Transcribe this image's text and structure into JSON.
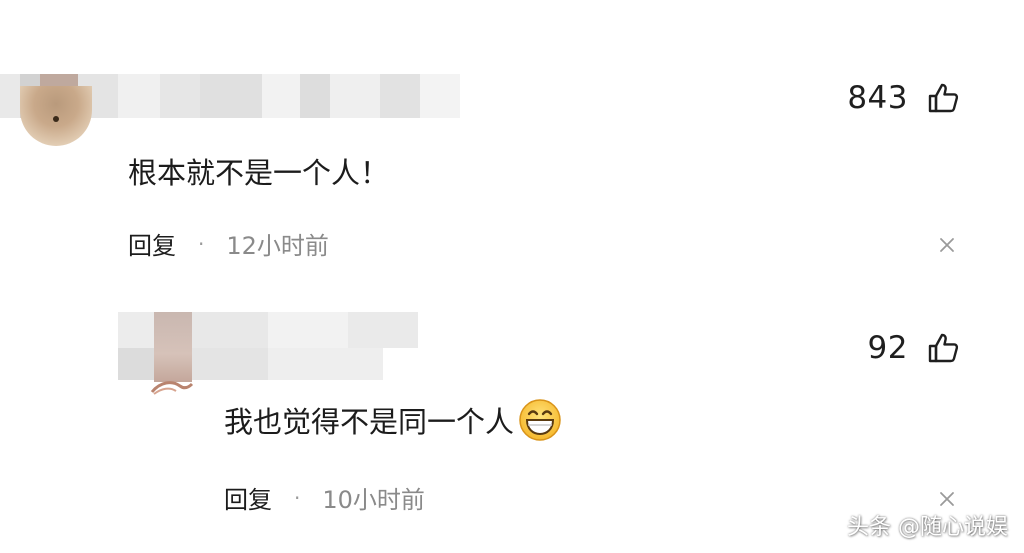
{
  "comments": [
    {
      "likes": "843",
      "text": "根本就不是一个人！",
      "reply_label": "回复",
      "separator": "·",
      "time": "12小时前"
    },
    {
      "likes": "92",
      "text": "我也觉得不是同一个人",
      "emoji": "grinning-face-emoji",
      "reply_label": "回复",
      "separator": "·",
      "time": "10小时前"
    }
  ],
  "icons": {
    "like": "thumbs-up-icon",
    "close": "close-icon"
  },
  "watermark": "头条 @随心说娱",
  "colors": {
    "text": "#1c1c1c",
    "muted": "#8a8a8a",
    "background": "#ffffff"
  }
}
